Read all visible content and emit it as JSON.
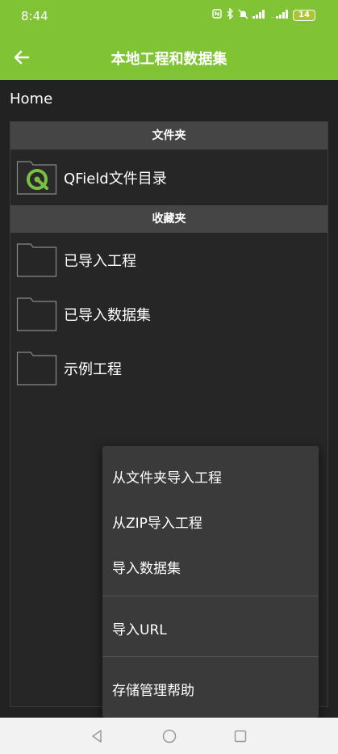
{
  "status": {
    "time": "8:44",
    "battery": "14",
    "icons": [
      "nfc-icon",
      "bluetooth-icon",
      "mute-icon",
      "signal-icon",
      "signal-icon"
    ]
  },
  "header": {
    "title": "本地工程和数据集",
    "back_icon": "arrow-left-icon"
  },
  "breadcrumb": "Home",
  "sections": {
    "folders_title": "文件夹",
    "folders": [
      {
        "label": "QField文件目录",
        "icon": "qfield-logo-icon"
      }
    ],
    "favorites_title": "收藏夹",
    "favorites": [
      {
        "label": "已导入工程",
        "icon": "folder-icon"
      },
      {
        "label": "已导入数据集",
        "icon": "folder-icon"
      },
      {
        "label": "示例工程",
        "icon": "folder-icon"
      }
    ]
  },
  "menu": {
    "items": [
      "从文件夹导入工程",
      "从ZIP导入工程",
      "导入数据集",
      "导入URL",
      "存储管理帮助"
    ]
  },
  "colors": {
    "accent": "#80c435",
    "background": "#222222",
    "section_header": "#454545",
    "menu_bg": "#3a3a3a"
  }
}
